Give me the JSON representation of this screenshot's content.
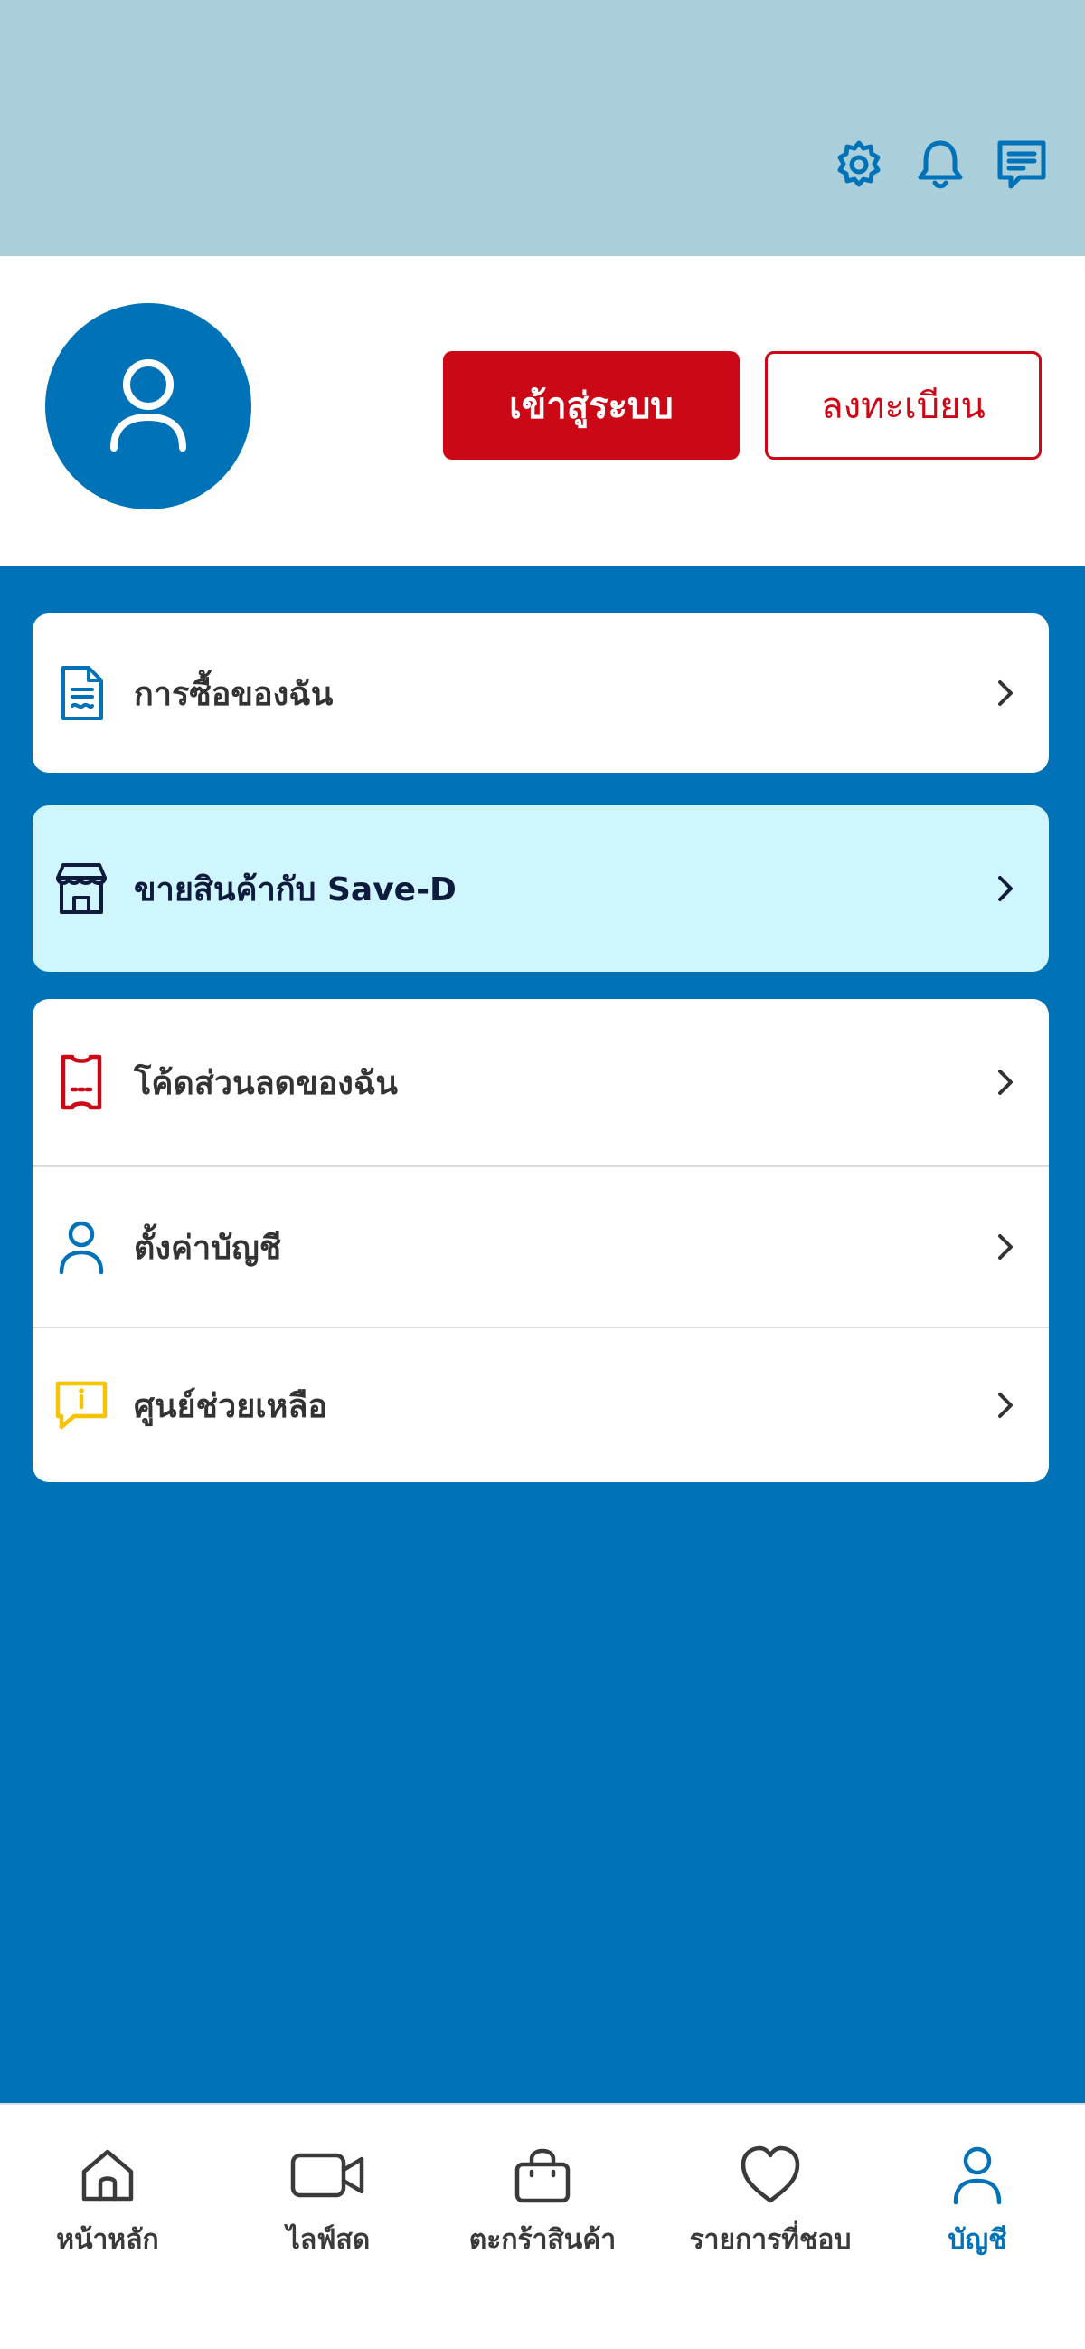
{
  "header": {
    "icons": [
      "gear-icon",
      "bell-icon",
      "chat-message-icon"
    ],
    "background_color": "#aacfdb",
    "icon_color": "#0073b8"
  },
  "profile": {
    "avatar_icon": "user-icon",
    "login_label": "เข้าสู่ระบบ",
    "register_label": "ลงทะเบียน",
    "accent_color": "#cc0816"
  },
  "menu": {
    "purchases": {
      "label": "การซื้อของฉัน",
      "icon": "document-icon"
    },
    "sell": {
      "label": "ขายสินค้ากับ Save-D",
      "icon": "store-icon"
    },
    "vouchers": {
      "label": "โค้ดส่วนลดของฉัน",
      "icon": "ticket-icon"
    },
    "account_settings": {
      "label": "ตั้งค่าบัญชี",
      "icon": "user-icon"
    },
    "help_center": {
      "label": "ศูนย์ช่วยเหลือ",
      "icon": "info-chat-icon"
    }
  },
  "bottom_nav": {
    "items": [
      {
        "label": "หน้าหลัก",
        "icon": "home-icon",
        "active": false
      },
      {
        "label": "ไลฟ์สด",
        "icon": "video-camera-icon",
        "active": false
      },
      {
        "label": "ตะกร้าสินค้า",
        "icon": "shopping-bag-icon",
        "active": false
      },
      {
        "label": "รายการที่ชอบ",
        "icon": "heart-icon",
        "active": false
      },
      {
        "label": "บัญชี",
        "icon": "user-icon",
        "active": true
      }
    ],
    "active_color": "#0073b8"
  },
  "colors": {
    "primary_blue": "#0073b8",
    "highlight_bg": "#cff6fc",
    "warning_yellow": "#f5c400"
  }
}
